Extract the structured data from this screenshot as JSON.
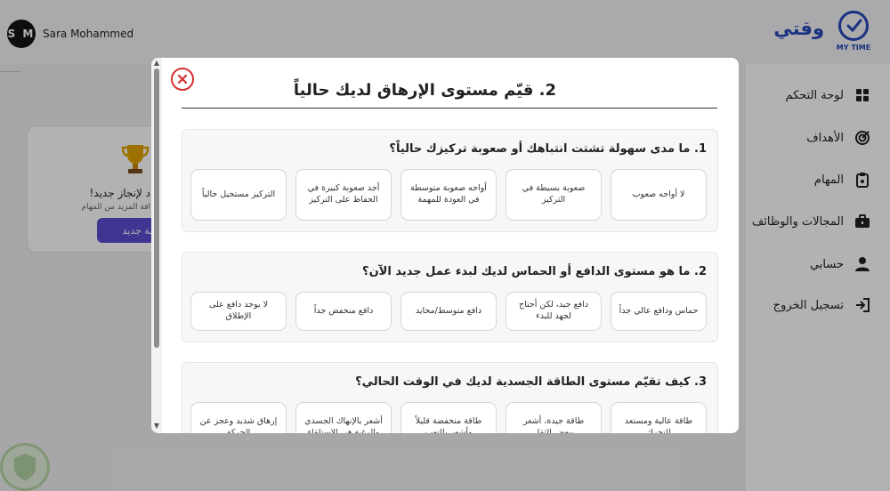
{
  "user": {
    "initials": "S M",
    "name": "Sara Mohammed"
  },
  "brand": {
    "name": "وقتي",
    "logo_caption": "MY TIME",
    "color": "#2447b8"
  },
  "goal_card": {
    "title": "د لإنجاز جديد!",
    "subtitle": "افة المزيد من المهام",
    "button": "همة جديد",
    "icon": "trophy-icon"
  },
  "sidebar": {
    "items": [
      {
        "label": "لوحة التحكم",
        "icon": "dashboard-icon"
      },
      {
        "label": "الأهداف",
        "icon": "target-icon"
      },
      {
        "label": "المهام",
        "icon": "clipboard-icon"
      },
      {
        "label": "المجالات والوظائف",
        "icon": "briefcase-icon"
      },
      {
        "label": "حسابي",
        "icon": "user-icon"
      },
      {
        "label": "تسجيل الخروج",
        "icon": "logout-icon"
      }
    ]
  },
  "modal": {
    "title": "2. قيّم مستوى الإرهاق لديك حالياً",
    "close_icon": "close-icon",
    "accent": "#d32f2f",
    "questions": [
      {
        "title": "1. ما مدى سهولة تشتت انتباهك أو صعوبة تركيزك حالياً؟",
        "options": [
          "لا أواجه صعوب",
          "صعوبة بسيطة في التركيز",
          "أواجه صعوبة متوسطة في العودة للمهمة",
          "أجد صعوبة كبيرة في الحفاظ على التركيز",
          "التركيز مستحيل حالياً"
        ]
      },
      {
        "title": "2. ما هو مستوى الدافع أو الحماس لديك لبدء عمل جديد الآن؟",
        "options": [
          "حماس ودافع عالي جداً",
          "دافع جيد، لكن أحتاج لجهد للبدء",
          "دافع متوسط/محايد",
          "دافع منخفض جداً",
          "لا يوجد دافع على الإطلاق"
        ]
      },
      {
        "title": "3. كيف تقيّم مستوى الطاقة الجسدية لديك في الوقت الحالي؟",
        "options": [
          "طاقة عالية ومستعد للتحرك",
          "طاقة جيدة، أشعر ببعض الثقل",
          "طاقة منخفضة قليلاً وأشعر بالتعب",
          "أشعر بالإنهاك الجسدي والرغبة في الاستلقاء",
          "إرهاق شديد وعجز عن الحركة"
        ]
      }
    ]
  }
}
